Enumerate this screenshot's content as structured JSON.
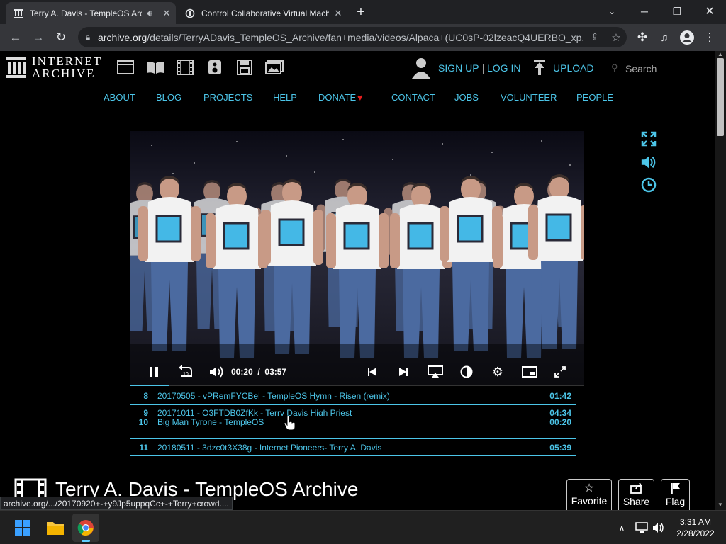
{
  "browser": {
    "tabs": [
      {
        "title": "Terry A. Davis - TempleOS Archive",
        "active": true
      },
      {
        "title": "Control Collaborative Virtual Machine",
        "active": false
      }
    ],
    "new_tab": "+",
    "url_host": "archive.org",
    "url_path": "/details/TerryADavis_TempleOS_Archive/fan+media/videos/Alpaca+(UC0sP-02lzeacQ4UERBO_xp..."
  },
  "ia": {
    "logo_line1": "INTERNET",
    "logo_line2": "ARCHIVE",
    "sign_up": "SIGN UP",
    "separator": "|",
    "log_in": "LOG IN",
    "upload": "UPLOAD",
    "search_placeholder": "Search",
    "nav": [
      "ABOUT",
      "BLOG",
      "PROJECTS",
      "HELP",
      "DONATE",
      "CONTACT",
      "JOBS",
      "VOLUNTEER",
      "PEOPLE"
    ],
    "donate_heart": "♥"
  },
  "player": {
    "time_current": "00:20",
    "time_sep": "/",
    "time_total": "03:57",
    "progress": 0.084
  },
  "playlist": [
    {
      "num": "8",
      "title": "20170505 - vPRemFYCBel - TempleOS Hymn - Risen (remix)",
      "duration": "01:42"
    },
    {
      "num": "9",
      "title": "20171011 - O3FTDB0ZfKk - Terry Davis High Priest",
      "duration": "04:34"
    },
    {
      "num": "10",
      "title": "Big Man Tyrone - TempleOS",
      "duration": "00:20"
    },
    {
      "num": "11",
      "title": "20180511 - 3dzc0t3X38g - Internet Pioneers- Terry A. Davis",
      "duration": "05:39"
    }
  ],
  "page": {
    "title": "Terry A. Davis - TempleOS Archive",
    "favorite": "Favorite",
    "share": "Share",
    "flag": "Flag"
  },
  "statusbar": "archive.org/.../20170920+-+y9Jp5uppqCc+-+Terry+crowd....",
  "taskbar": {
    "time": "3:31 AM",
    "date": "2/28/2022"
  },
  "colors": {
    "accent": "#4cc5e8",
    "heart": "#e31d1d",
    "background": "#000000"
  }
}
